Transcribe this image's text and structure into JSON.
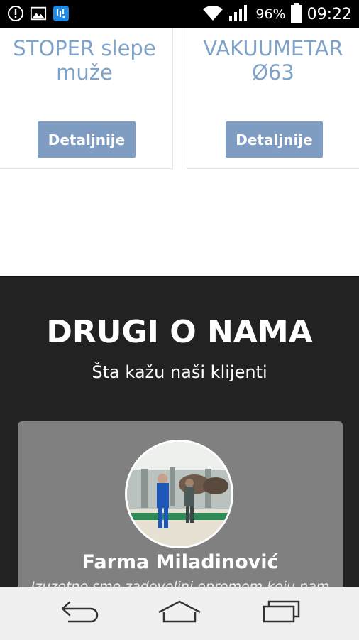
{
  "status_bar": {
    "battery": "96%",
    "time": "09:22",
    "icons": [
      "shield-alert-icon",
      "gallery-icon",
      "app-notification-icon",
      "wifi-icon",
      "signal-icon",
      "battery-icon"
    ]
  },
  "products": [
    {
      "title_line1": "STOPER slepe",
      "title_line2": "muže",
      "button_label": "Detaljnije"
    },
    {
      "title_line1": "VAKUUMETAR",
      "title_line2": "Ø63",
      "button_label": "Detaljnije"
    }
  ],
  "testimonials": {
    "title": "DRUGI O NAMA",
    "subtitle": "Šta kažu naši klijenti",
    "items": [
      {
        "name": "Farma Miladinović",
        "quote": "Izuzetno smo zadovoljni opremom koju nam"
      }
    ]
  },
  "nav_bar": {
    "icons": [
      "back-icon",
      "home-icon",
      "recent-apps-icon"
    ]
  },
  "colors": {
    "accent": "#7f9dc2",
    "title_blue": "#7fa3c8",
    "dark_bg": "#222222",
    "card_gray": "#808080"
  }
}
